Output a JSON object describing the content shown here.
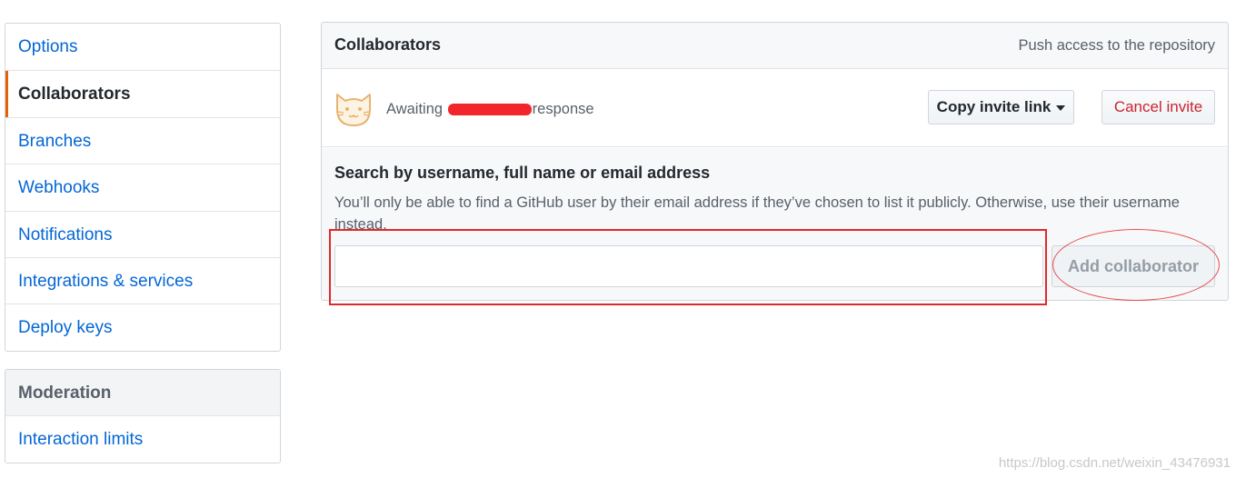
{
  "sidebar": {
    "items": [
      {
        "label": "Options"
      },
      {
        "label": "Collaborators",
        "selected": true
      },
      {
        "label": "Branches"
      },
      {
        "label": "Webhooks"
      },
      {
        "label": "Notifications"
      },
      {
        "label": "Integrations & services"
      },
      {
        "label": "Deploy keys"
      }
    ],
    "moderation": {
      "heading": "Moderation",
      "items": [
        {
          "label": "Interaction limits"
        }
      ]
    }
  },
  "collaborators": {
    "title": "Collaborators",
    "note": "Push access to the repository",
    "invite": {
      "awaiting_prefix": "Awaiting",
      "awaiting_suffix": "response",
      "avatar_icon": "cat-face-icon",
      "copy_invite_label": "Copy invite link",
      "cancel_invite_label": "Cancel invite"
    },
    "search": {
      "label": "Search by username, full name or email address",
      "note": "You’ll only be able to find a GitHub user by their email address if they’ve chosen to list it publicly. Otherwise, use their username instead.",
      "input_value": "",
      "add_button_label": "Add collaborator"
    }
  },
  "colors": {
    "link": "#0366d6",
    "selected_accent": "#e36209",
    "danger": "#cb2431",
    "annotation": "#e02a2a",
    "redaction": "#f2262a"
  },
  "watermark": "https://blog.csdn.net/weixin_43476931"
}
